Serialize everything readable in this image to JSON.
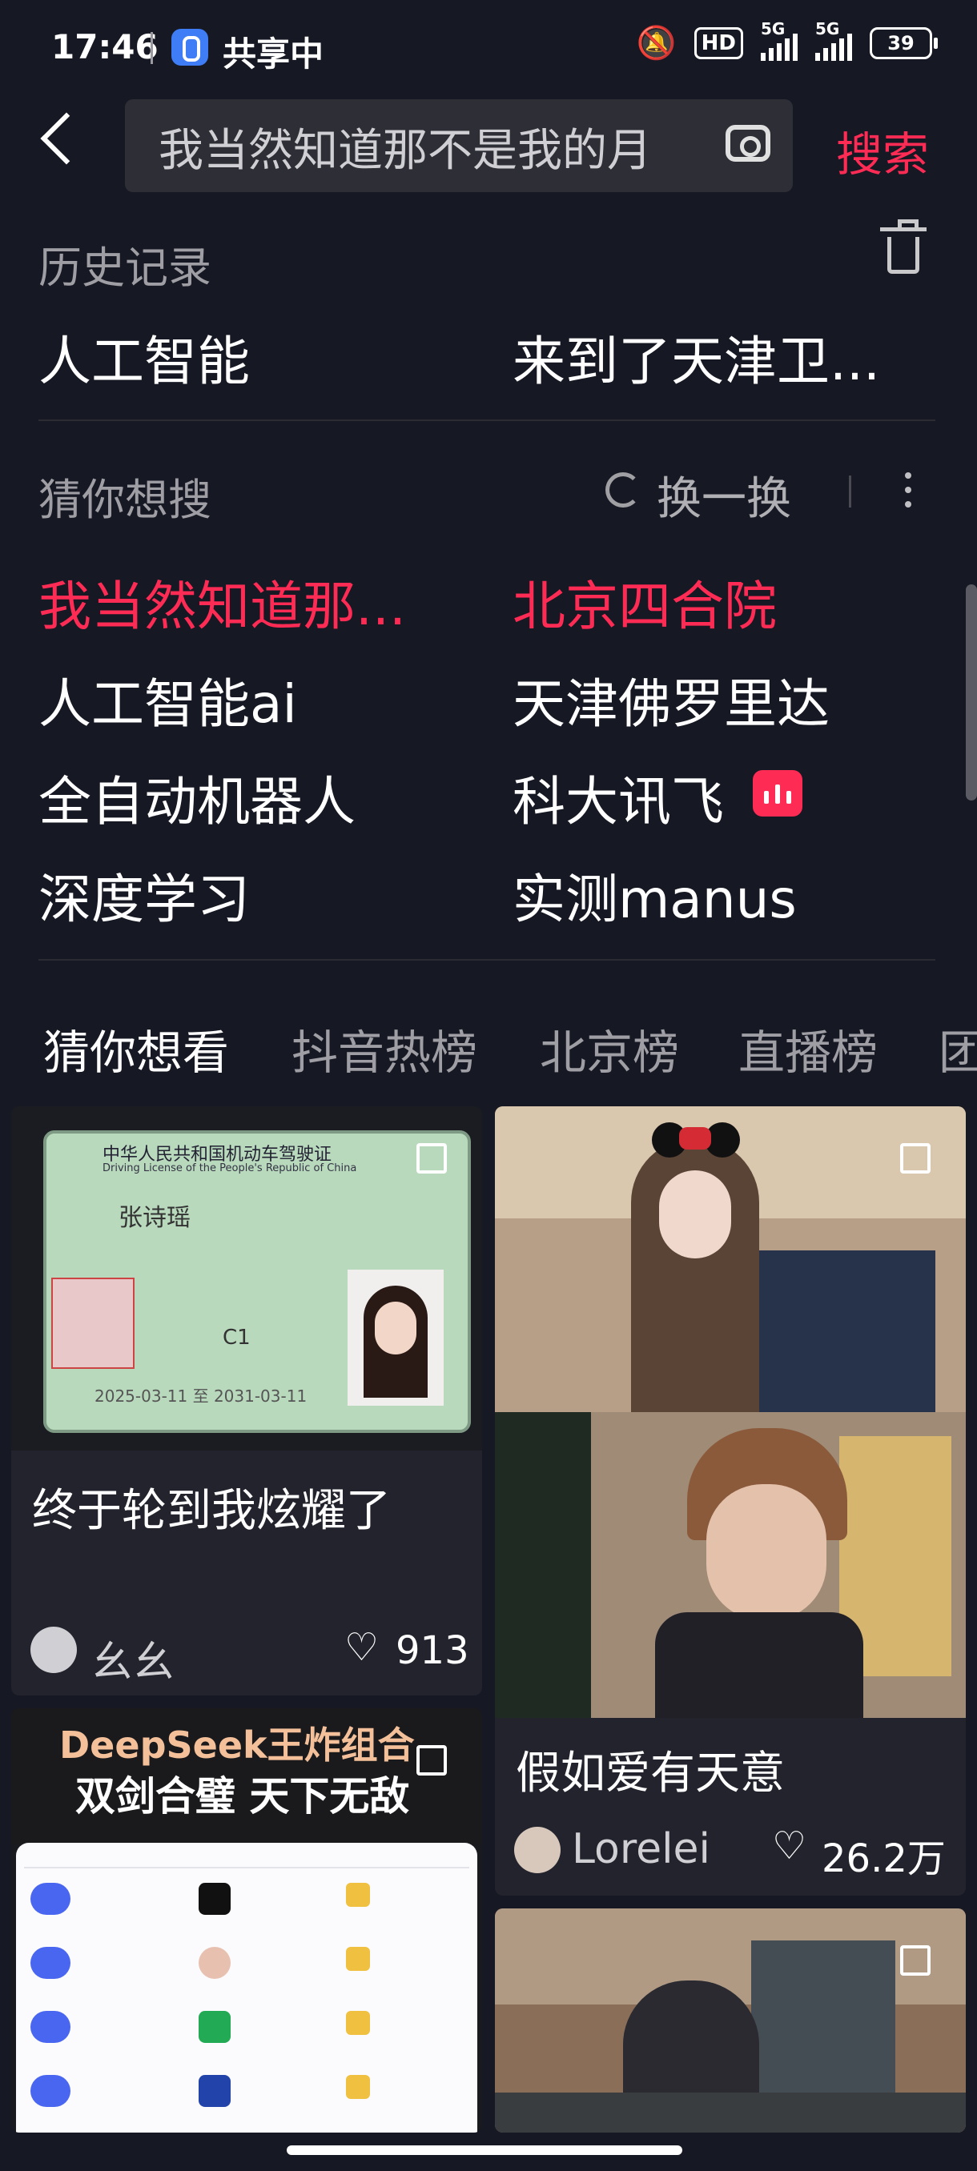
{
  "status": {
    "time": "17:46",
    "share_label": "共享中",
    "hd": "HD",
    "signal1": "5G",
    "signal2": "5G",
    "battery": "39"
  },
  "search": {
    "query": "我当然知道那不是我的月",
    "button": "搜索"
  },
  "history": {
    "title": "历史记录",
    "items": [
      "人工智能",
      "来到了天津卫..."
    ]
  },
  "guess": {
    "title": "猜你想搜",
    "refresh": "换一换",
    "items": [
      "我当然知道那...",
      "北京四合院",
      "人工智能ai",
      "天津佛罗里达",
      "全自动机器人",
      "科大讯飞",
      "深度学习",
      "实测manus"
    ]
  },
  "tabs": [
    "猜你想看",
    "抖音热榜",
    "北京榜",
    "直播榜",
    "团"
  ],
  "cards": {
    "card1": {
      "title": "终于轮到我炫耀了",
      "author": "幺幺",
      "likes": "913"
    },
    "card2": {
      "title": "假如爱有天意",
      "author": "Lorelei",
      "likes": "26.2万"
    },
    "card3": {
      "headline1": "DeepSeek王炸组合",
      "headline2": "双剑合璧 天下无敌"
    },
    "license": {
      "title_cn": "中华人民共和国机动车驾驶证",
      "title_en": "Driving License of the People's Republic of China",
      "name": "张诗瑶",
      "class": "C1",
      "dates": "2025-03-11 至 2031-03-11"
    }
  },
  "colors": {
    "accent": "#fe2c55",
    "bg": "#161823"
  }
}
